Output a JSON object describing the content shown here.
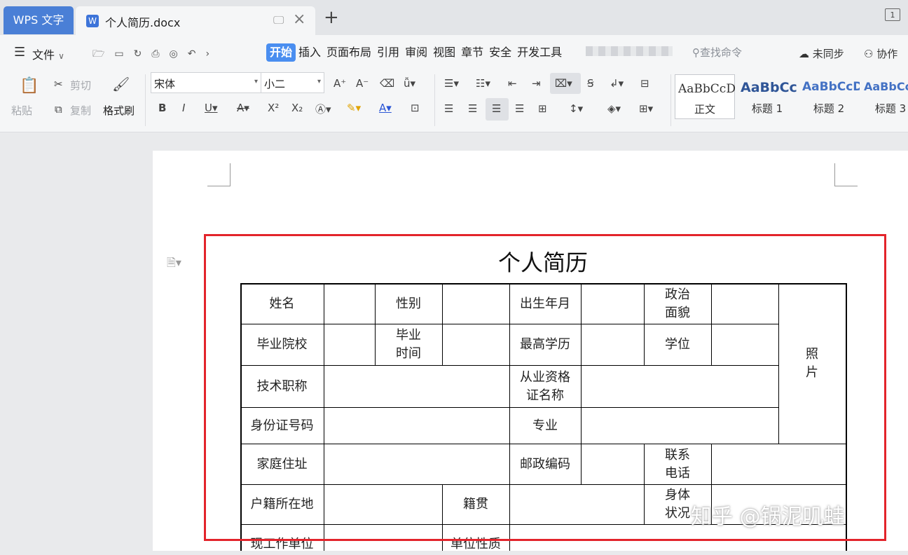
{
  "titlebar": {
    "app_tab": "WPS 文字",
    "doc_tab": "个人简历.docx",
    "doc_icon": "W",
    "new_tab": "+",
    "window_badge": "1"
  },
  "menubar": {
    "file": "文件",
    "tabs": [
      "开始",
      "插入",
      "页面布局",
      "引用",
      "审阅",
      "视图",
      "章节",
      "安全",
      "开发工具"
    ],
    "search_placeholder": "查找命令",
    "sync": "未同步",
    "collab": "协作"
  },
  "ribbon": {
    "paste": "粘贴",
    "cut": "剪切",
    "copy": "复制",
    "format_painter": "格式刷",
    "font_name": "宋体",
    "font_size": "小二",
    "styles": [
      {
        "sample": "AaBbCcDd",
        "name": "正文",
        "color": "#222222"
      },
      {
        "sample": "AaBbCc",
        "name": "标题 1",
        "color": "#2f5597"
      },
      {
        "sample": "AaBbCcD",
        "name": "标题 2",
        "color": "#4472c4"
      },
      {
        "sample": "AaBbCcI",
        "name": "标题 3",
        "color": "#4472c4"
      }
    ]
  },
  "document": {
    "title": "个人简历",
    "labels": {
      "name": "姓名",
      "gender": "性别",
      "birth": "出生年月",
      "political": "政治\n面貌",
      "photo": "照\n片",
      "school": "毕业院校",
      "grad_time": "毕业\n时间",
      "education": "最高学历",
      "degree": "学位",
      "title": "技术职称",
      "qualification": "从业资格\n证名称",
      "id_number": "身份证号码",
      "major": "专业",
      "address": "家庭住址",
      "postcode": "邮政编码",
      "phone": "联系\n电话",
      "household": "户籍所在地",
      "native": "籍贯",
      "health": "身体\n状况",
      "employer": "现工作单位",
      "employer_type": "单位性质"
    }
  },
  "watermark": "知乎 @锅泥叽蛙"
}
